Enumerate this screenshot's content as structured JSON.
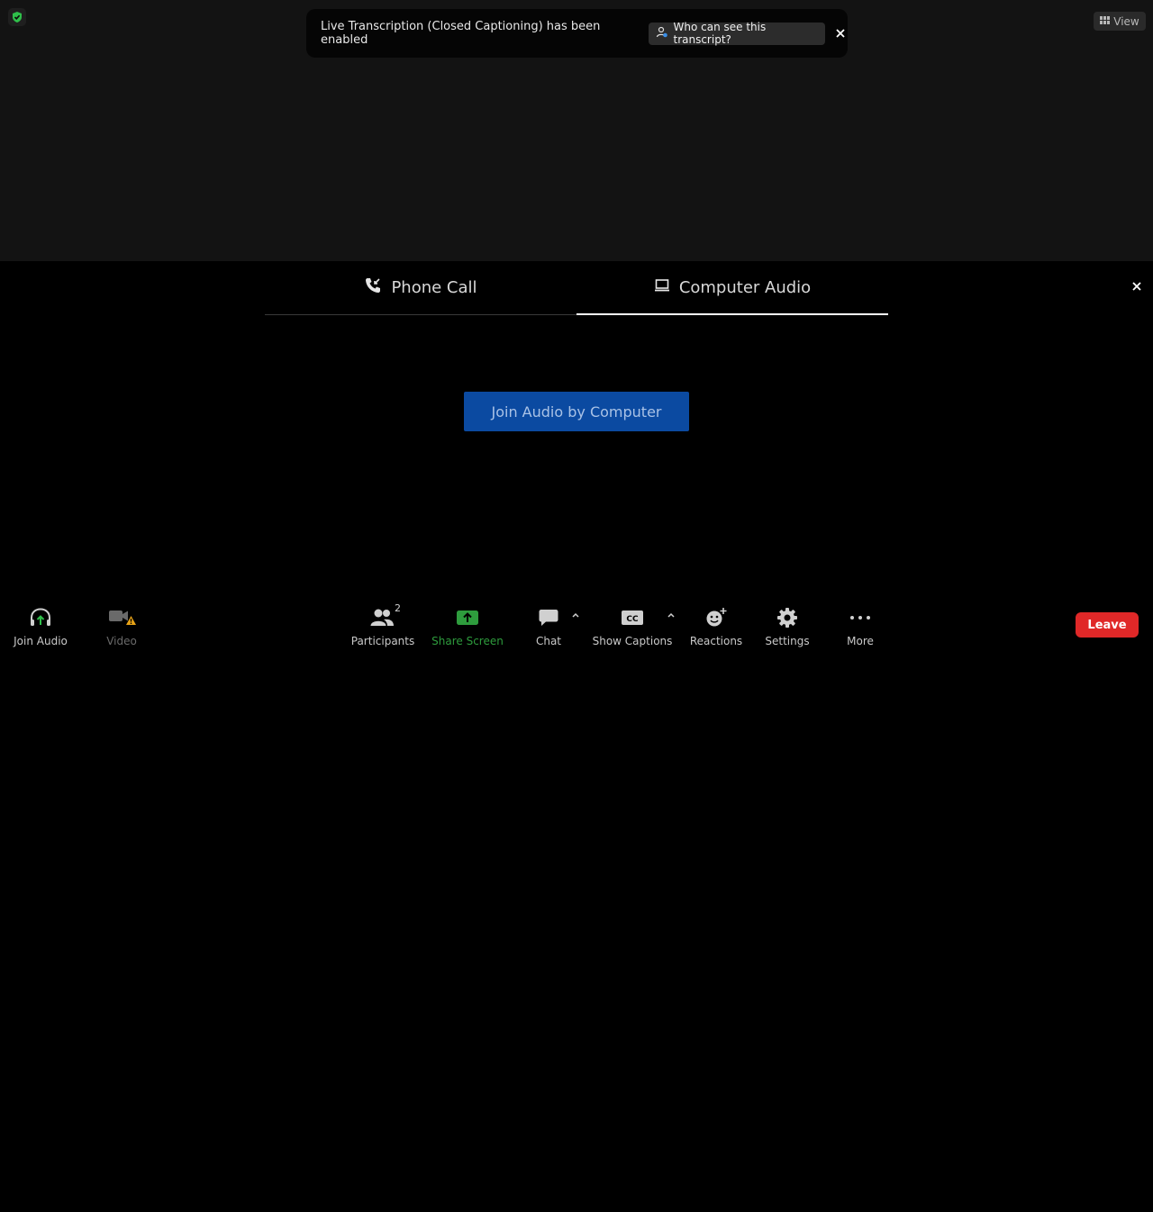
{
  "banner": {
    "message": "Live Transcription (Closed Captioning) has been enabled",
    "who_button": "Who can see this transcript?"
  },
  "view_button": "View",
  "audio_dialog": {
    "tabs": [
      {
        "label": "Phone Call",
        "icon": "phone-icon",
        "active": false
      },
      {
        "label": "Computer Audio",
        "icon": "laptop-icon",
        "active": true
      }
    ],
    "join_button": "Join Audio by Computer"
  },
  "toolbar": {
    "join_audio": "Join Audio",
    "video": "Video",
    "participants": "Participants",
    "participants_count": "2",
    "share_screen": "Share Screen",
    "chat": "Chat",
    "show_captions": "Show Captions",
    "captions_icon_text": "CC",
    "reactions": "Reactions",
    "settings": "Settings",
    "more": "More",
    "leave": "Leave"
  },
  "colors": {
    "accent_green": "#2e9c3d",
    "leave_red": "#e02828",
    "join_blue": "#0b4aa1",
    "warning": "#e8a317"
  }
}
